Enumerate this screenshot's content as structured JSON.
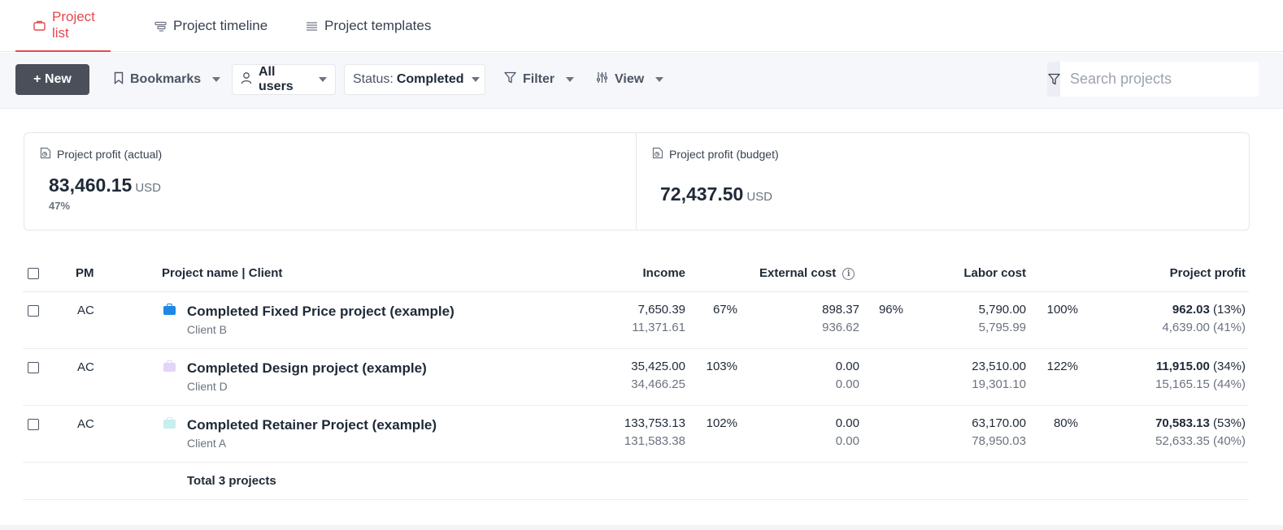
{
  "tabs": [
    {
      "label": "Project list",
      "icon": "briefcase-icon",
      "active": true
    },
    {
      "label": "Project timeline",
      "icon": "timeline-icon",
      "active": false
    },
    {
      "label": "Project templates",
      "icon": "list-icon",
      "active": false
    }
  ],
  "toolbar": {
    "new_label": "+ New",
    "bookmarks_label": "Bookmarks",
    "users_label": "All users",
    "status_label": "Status:",
    "status_value": "Completed",
    "filter_label": "Filter",
    "view_label": "View",
    "search_placeholder": "Search projects"
  },
  "summary": {
    "actual": {
      "title": "Project profit (actual)",
      "value": "83,460.15",
      "unit": "USD",
      "pct": "47%"
    },
    "budget": {
      "title": "Project profit (budget)",
      "value": "72,437.50",
      "unit": "USD"
    }
  },
  "table": {
    "headers": {
      "pm": "PM",
      "name": "Project name | Client",
      "income": "Income",
      "external": "External cost",
      "labor": "Labor cost",
      "profit": "Project profit"
    },
    "rows": [
      {
        "pm": "AC",
        "name": "Completed Fixed Price project (example)",
        "client": "Client B",
        "color": "#1e88e5",
        "income": "7,650.39",
        "income_budget": "11,371.61",
        "income_pct": "67%",
        "external": "898.37",
        "external_budget": "936.62",
        "external_pct": "96%",
        "labor": "5,790.00",
        "labor_budget": "5,795.99",
        "labor_pct": "100%",
        "profit": "962.03",
        "profit_pct": "(13%)",
        "profit_budget": "4,639.00 (41%)"
      },
      {
        "pm": "AC",
        "name": "Completed Design project (example)",
        "client": "Client D",
        "color": "#e4d4f7",
        "income": "35,425.00",
        "income_budget": "34,466.25",
        "income_pct": "103%",
        "external": "0.00",
        "external_budget": "0.00",
        "external_pct": "",
        "labor": "23,510.00",
        "labor_budget": "19,301.10",
        "labor_pct": "122%",
        "profit": "11,915.00",
        "profit_pct": "(34%)",
        "profit_budget": "15,165.15 (44%)"
      },
      {
        "pm": "AC",
        "name": "Completed Retainer Project (example)",
        "client": "Client A",
        "color": "#c6efee",
        "income": "133,753.13",
        "income_budget": "131,583.38",
        "income_pct": "102%",
        "external": "0.00",
        "external_budget": "0.00",
        "external_pct": "",
        "labor": "63,170.00",
        "labor_budget": "78,950.03",
        "labor_pct": "80%",
        "profit": "70,583.13",
        "profit_pct": "(53%)",
        "profit_budget": "52,633.35 (40%)"
      }
    ],
    "total_label": "Total 3 projects"
  }
}
